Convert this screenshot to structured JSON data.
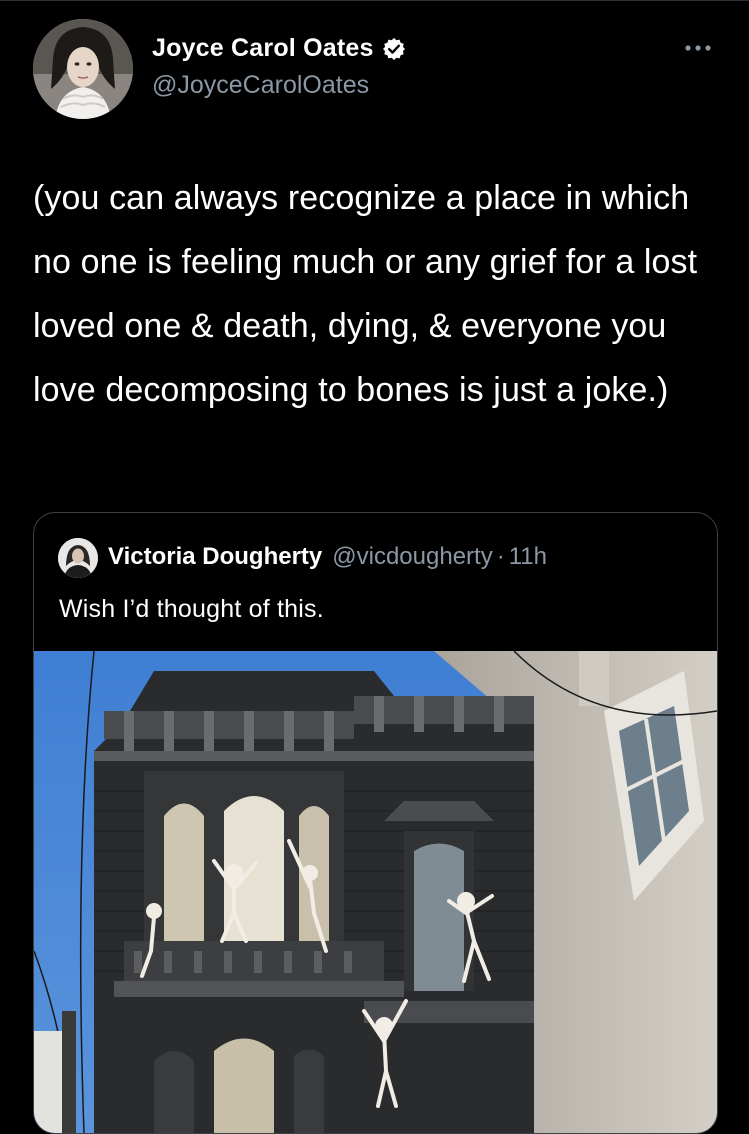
{
  "tweet": {
    "author": {
      "display_name": "Joyce Carol Oates",
      "handle": "@JoyceCarolOates",
      "verified": true,
      "avatar_icon": "author-avatar"
    },
    "more_icon": "more-options-icon",
    "text": "(you can always recognize a place in which no one is feeling much or any grief for a lost loved one & death, dying, & everyone you love decomposing to bones is just a joke.)",
    "quote": {
      "author": {
        "display_name": "Victoria Dougherty",
        "handle": "@vicdougherty",
        "separator": "·",
        "time": "11h"
      },
      "text": "Wish I’d thought of this.",
      "media_icon": "house-photo-with-skeletons"
    }
  },
  "colors": {
    "background": "#000000",
    "primary_text": "#ffffff",
    "secondary_text": "#8b98a5",
    "border": "#3e4144",
    "verified_badge": "#ffffff"
  }
}
